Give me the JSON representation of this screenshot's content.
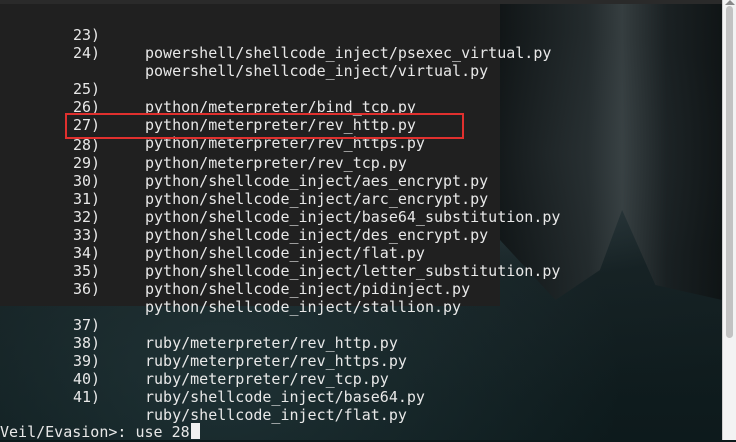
{
  "terminal": {
    "options": [
      {
        "num": "23)",
        "path": "powershell/shellcode_inject/psexec_virtual.py"
      },
      {
        "num": "24)",
        "path": "powershell/shellcode_inject/virtual.py"
      },
      {
        "num": "25)",
        "path": "python/meterpreter/bind_tcp.py"
      },
      {
        "num": "26)",
        "path": "python/meterpreter/rev_http.py"
      },
      {
        "num": "27)",
        "path": "python/meterpreter/rev_https.py"
      },
      {
        "num": "28)",
        "path": "python/meterpreter/rev_tcp.py"
      },
      {
        "num": "29)",
        "path": "python/shellcode_inject/aes_encrypt.py"
      },
      {
        "num": "30)",
        "path": "python/shellcode_inject/arc_encrypt.py"
      },
      {
        "num": "31)",
        "path": "python/shellcode_inject/base64_substitution.py"
      },
      {
        "num": "32)",
        "path": "python/shellcode_inject/des_encrypt.py"
      },
      {
        "num": "33)",
        "path": "python/shellcode_inject/flat.py"
      },
      {
        "num": "34)",
        "path": "python/shellcode_inject/letter_substitution.py"
      },
      {
        "num": "35)",
        "path": "python/shellcode_inject/pidinject.py"
      },
      {
        "num": "36)",
        "path": "python/shellcode_inject/stallion.py"
      },
      {
        "num": "37)",
        "path": "ruby/meterpreter/rev_http.py"
      },
      {
        "num": "38)",
        "path": "ruby/meterpreter/rev_https.py"
      },
      {
        "num": "39)",
        "path": "ruby/meterpreter/rev_tcp.py"
      },
      {
        "num": "40)",
        "path": "ruby/shellcode_inject/base64.py"
      },
      {
        "num": "41)",
        "path": "ruby/shellcode_inject/flat.py"
      }
    ],
    "highlighted_option": "28)",
    "prompt": "Veil/Evasion>:",
    "command": "use 28"
  },
  "colors": {
    "highlight_border": "#e0302e",
    "text": "#e8e8e8",
    "panel_bg": "#202020"
  }
}
